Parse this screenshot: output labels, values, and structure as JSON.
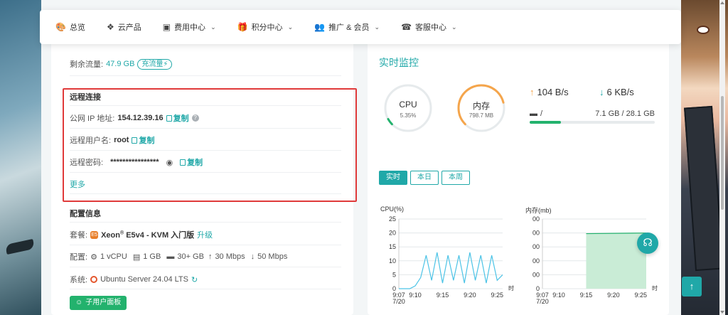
{
  "nav": {
    "items": [
      {
        "label": "总览",
        "icon": "palette-icon",
        "glyph": "🎨",
        "dropdown": false
      },
      {
        "label": "云产品",
        "icon": "cubes-icon",
        "glyph": "❖",
        "dropdown": false
      },
      {
        "label": "费用中心",
        "icon": "money-icon",
        "glyph": "▣",
        "dropdown": true
      },
      {
        "label": "积分中心",
        "icon": "gift-icon",
        "glyph": "🎁",
        "dropdown": true
      },
      {
        "label": "推广 & 会员",
        "icon": "users-icon",
        "glyph": "👥",
        "dropdown": true
      },
      {
        "label": "客服中心",
        "icon": "headset-icon",
        "glyph": "☎",
        "dropdown": true
      }
    ]
  },
  "traffic": {
    "label": "剩余流量:",
    "value": "47.9 GB",
    "button": "充流量"
  },
  "remote": {
    "title": "远程连接",
    "ip_label": "公网 IP 地址:",
    "ip": "154.12.39.16",
    "user_label": "远程用户名:",
    "user": "root",
    "pass_label": "远程密码:",
    "pass": "****************",
    "copy": "复制",
    "more": "更多"
  },
  "config": {
    "title": "配置信息",
    "plan_label": "套餐:",
    "plan_name": "Xeon",
    "plan_sup": "®",
    "plan_rest": "E5v4 - KVM 入门版",
    "upgrade": "升级",
    "spec_label": "配置:",
    "cpu": "1 vCPU",
    "ram": "1 GB",
    "disk": "30+ GB",
    "up": "30 Mbps",
    "down": "50 Mbps",
    "sys_label": "系统:",
    "os": "Ubuntu Server 24.04 LTS",
    "sub_panel": "子用户面板"
  },
  "monitor": {
    "title": "实时监控",
    "cpu_label": "CPU",
    "cpu_value": "5.35%",
    "cpu_fraction": 0.0535,
    "mem_label": "内存",
    "mem_value": "798.7 MB",
    "mem_fraction": 0.78,
    "upload": "104 B/s",
    "download": "6 KB/s",
    "disk_mount": "/",
    "disk_usage": "7.1 GB / 28.1 GB",
    "disk_fraction": 0.25,
    "tabs": [
      "实时",
      "本日",
      "本周"
    ],
    "active_tab": 0
  },
  "chart_data": [
    {
      "type": "line",
      "title": "CPU(%)",
      "xlabel": "时",
      "ylim": [
        0,
        25
      ],
      "yticks": [
        0,
        5,
        10,
        15,
        20,
        25
      ],
      "xticks": [
        "9:07\n7/20",
        "9:10",
        "9:15",
        "9:20",
        "9:25"
      ],
      "x_minutes": [
        7,
        8,
        9,
        10,
        11,
        12,
        13,
        14,
        15,
        16,
        17,
        18,
        19,
        20,
        21,
        22,
        23,
        24,
        25,
        26
      ],
      "series": [
        {
          "values": [
            0,
            0,
            0,
            1,
            4,
            12,
            3,
            13,
            2,
            12,
            3,
            12,
            2,
            13,
            3,
            12,
            2,
            12,
            3,
            5
          ]
        }
      ]
    },
    {
      "type": "area",
      "title": "内存(mb)",
      "xlabel": "时",
      "ylim": [
        0,
        1000
      ],
      "yticks": [
        "0",
        "200",
        "400",
        "600",
        "800",
        "1000"
      ],
      "ytick_labels": [
        "0",
        "00",
        "00",
        "00",
        "00",
        "00"
      ],
      "xticks": [
        "9:07\n7/20",
        "9:10",
        "9:15",
        "9:20",
        "9:25"
      ],
      "x_minutes": [
        15,
        26
      ],
      "series": [
        {
          "values": [
            790,
            799
          ]
        }
      ]
    }
  ]
}
